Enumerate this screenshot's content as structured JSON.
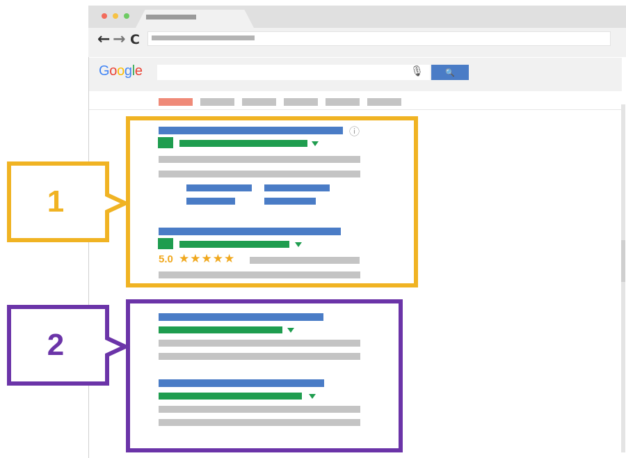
{
  "browser": {
    "traffic_lights": [
      "#f26b5b",
      "#f6c244",
      "#6ecb63"
    ],
    "back_icon": "←",
    "forward_icon": "→",
    "reload_icon": "C"
  },
  "search": {
    "logo": [
      "G",
      "o",
      "o",
      "g",
      "l",
      "e"
    ],
    "logo_colors": [
      "#4285f4",
      "#ea4335",
      "#fbbc05",
      "#4285f4",
      "#34a853",
      "#ea4335"
    ],
    "mic_icon": "🎙",
    "search_icon": "🔍"
  },
  "callouts": {
    "one": {
      "label": "1",
      "color": "#f0b323"
    },
    "two": {
      "label": "2",
      "color": "#6b34a8"
    }
  },
  "results": {
    "rating": "5.0",
    "stars": "★★★★★",
    "info_icon": "ⓘ"
  }
}
